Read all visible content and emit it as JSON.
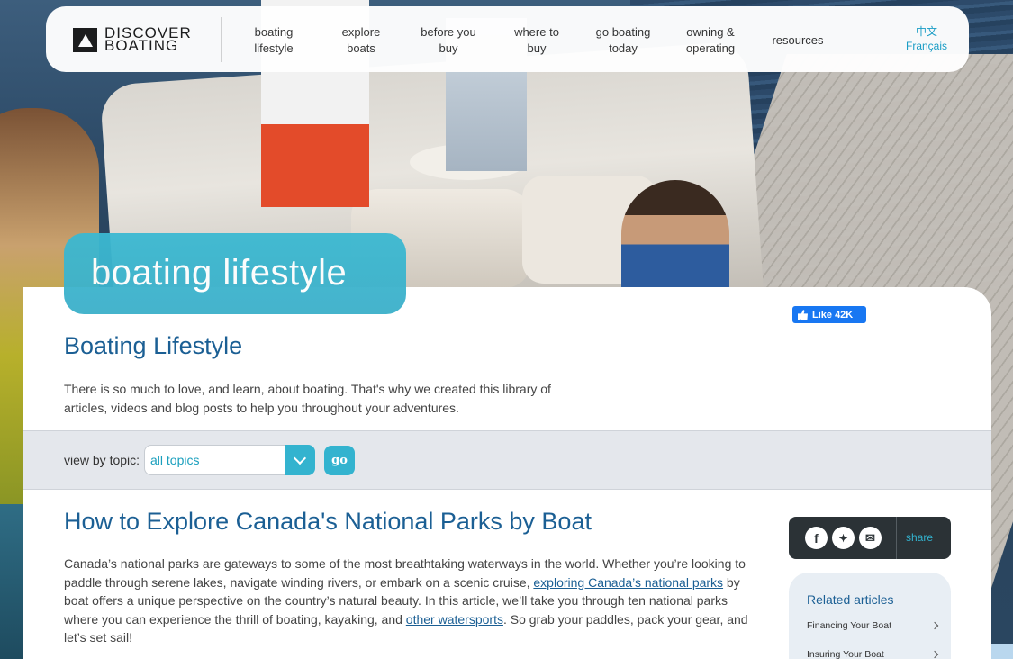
{
  "nav": {
    "logo_line1": "DISCOVER",
    "logo_line2": "BOATING",
    "items": [
      {
        "label": "boating\nlifestyle"
      },
      {
        "label": "explore\nboats"
      },
      {
        "label": "before you\nbuy"
      },
      {
        "label": "where to\nbuy"
      },
      {
        "label": "go boating\ntoday"
      },
      {
        "label": "owning &\noperating"
      },
      {
        "label": "resources"
      }
    ],
    "lang_zh": "中文",
    "lang_fr": "Français"
  },
  "hero": {
    "badge": "boating lifestyle"
  },
  "facebook": {
    "like_label": "Like 42K"
  },
  "page": {
    "title": "Boating Lifestyle",
    "intro": "There is so much to love, and learn, about boating. That's why we created this library of articles, videos and blog posts to help you throughout your adventures."
  },
  "topic_filter": {
    "label": "view by topic:",
    "selected": "all topics",
    "go_label": "go"
  },
  "article": {
    "title": "How to Explore Canada's National Parks by Boat",
    "text_1": "Canada’s national parks are gateways to some of the most breathtaking waterways in the world. Whether you’re looking to paddle through serene lakes, navigate winding rivers, or embark on a scenic cruise, ",
    "link_1": "exploring Canada’s national parks",
    "text_2": " by boat offers a unique perspective on the country’s natural beauty. In this article, we’ll take you through ten national parks where you can experience the thrill of boating, kayaking, and ",
    "link_2": "other watersports",
    "text_3": ". So grab your paddles, pack your gear, and let’s set sail!"
  },
  "share": {
    "label": "share",
    "icons": [
      "facebook-icon",
      "twitter-icon",
      "email-icon"
    ]
  },
  "related": {
    "heading": "Related articles",
    "items": [
      {
        "label": "Financing Your Boat"
      },
      {
        "label": "Insuring Your Boat"
      }
    ]
  },
  "colors": {
    "accent": "#33b3cf",
    "title_blue": "#1b5f94",
    "facebook_blue": "#1877f2",
    "share_dark": "#2b3236"
  }
}
